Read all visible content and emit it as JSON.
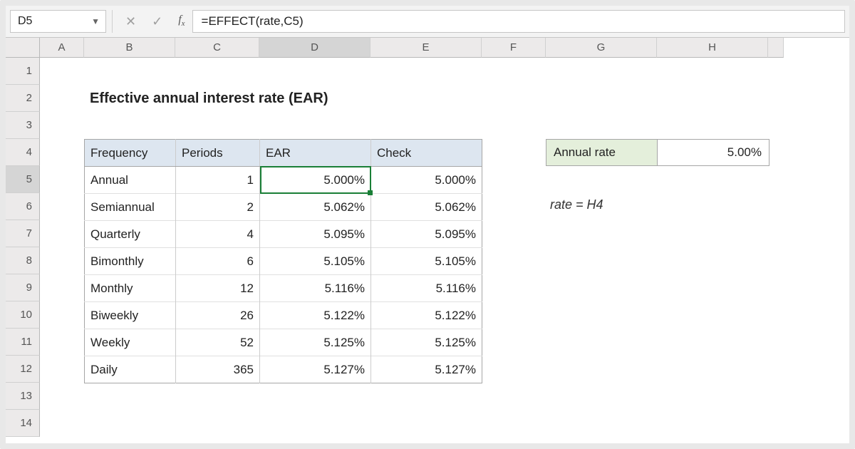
{
  "formula_bar": {
    "name_box": "D5",
    "formula": "=EFFECT(rate,C5)"
  },
  "columns": [
    "A",
    "B",
    "C",
    "D",
    "E",
    "F",
    "G",
    "H"
  ],
  "rows": [
    "1",
    "2",
    "3",
    "4",
    "5",
    "6",
    "7",
    "8",
    "9",
    "10",
    "11",
    "12",
    "13",
    "14"
  ],
  "active_col": "D",
  "active_row": "5",
  "title": "Effective annual interest rate (EAR)",
  "table": {
    "headers": {
      "freq": "Frequency",
      "periods": "Periods",
      "ear": "EAR",
      "check": "Check"
    },
    "rows": [
      {
        "freq": "Annual",
        "periods": "1",
        "ear": "5.000%",
        "check": "5.000%"
      },
      {
        "freq": "Semiannual",
        "periods": "2",
        "ear": "5.062%",
        "check": "5.062%"
      },
      {
        "freq": "Quarterly",
        "periods": "4",
        "ear": "5.095%",
        "check": "5.095%"
      },
      {
        "freq": "Bimonthly",
        "periods": "6",
        "ear": "5.105%",
        "check": "5.105%"
      },
      {
        "freq": "Monthly",
        "periods": "12",
        "ear": "5.116%",
        "check": "5.116%"
      },
      {
        "freq": "Biweekly",
        "periods": "26",
        "ear": "5.122%",
        "check": "5.122%"
      },
      {
        "freq": "Weekly",
        "periods": "52",
        "ear": "5.125%",
        "check": "5.125%"
      },
      {
        "freq": "Daily",
        "periods": "365",
        "ear": "5.127%",
        "check": "5.127%"
      }
    ]
  },
  "annual_rate": {
    "label": "Annual rate",
    "value": "5.00%"
  },
  "note": "rate = H4"
}
